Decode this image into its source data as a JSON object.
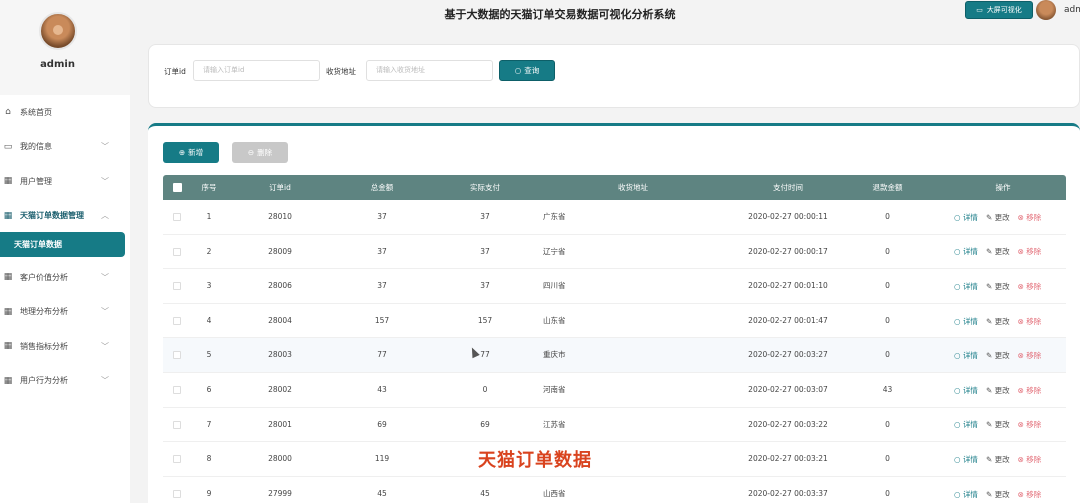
{
  "app": {
    "title": "基于大数据的天猫订单交易数据可视化分析系统",
    "bigscreen_label": "大屏可视化",
    "username": "admin",
    "username_top": "adm"
  },
  "sidebar": {
    "items": [
      {
        "label": "系统首页",
        "icon": "home-icon",
        "has_chevron": false
      },
      {
        "label": "我的信息",
        "icon": "user-card-icon",
        "has_chevron": true
      },
      {
        "label": "用户管理",
        "icon": "grid-icon",
        "has_chevron": true
      },
      {
        "label": "天猫订单数据管理",
        "icon": "grid-icon",
        "has_chevron": true,
        "open": true
      },
      {
        "label": "客户价值分析",
        "icon": "grid-icon",
        "has_chevron": true
      },
      {
        "label": "地理分布分析",
        "icon": "grid-icon",
        "has_chevron": true
      },
      {
        "label": "销售指标分析",
        "icon": "grid-icon",
        "has_chevron": true
      },
      {
        "label": "用户行为分析",
        "icon": "grid-icon",
        "has_chevron": true
      }
    ],
    "active_sub": "天猫订单数据"
  },
  "search": {
    "order_label": "订单id",
    "order_placeholder": "请输入订单id",
    "address_label": "收货地址",
    "address_placeholder": "请输入收货地址",
    "button": "查询"
  },
  "toolbar": {
    "add": "新增",
    "delete": "删除"
  },
  "table": {
    "headers": [
      "序号",
      "订单id",
      "总金额",
      "实际支付",
      "收货地址",
      "支付时间",
      "退款金额",
      "操作"
    ],
    "actions": {
      "detail": "详情",
      "edit": "更改",
      "remove": "移除"
    },
    "rows": [
      {
        "no": "1",
        "order_id": "28010",
        "total": "37",
        "paid": "37",
        "address": "广东省",
        "pay_time": "2020-02-27 00:00:11",
        "refund": "0"
      },
      {
        "no": "2",
        "order_id": "28009",
        "total": "37",
        "paid": "37",
        "address": "辽宁省",
        "pay_time": "2020-02-27 00:00:17",
        "refund": "0"
      },
      {
        "no": "3",
        "order_id": "28006",
        "total": "37",
        "paid": "37",
        "address": "四川省",
        "pay_time": "2020-02-27 00:01:10",
        "refund": "0"
      },
      {
        "no": "4",
        "order_id": "28004",
        "total": "157",
        "paid": "157",
        "address": "山东省",
        "pay_time": "2020-02-27 00:01:47",
        "refund": "0"
      },
      {
        "no": "5",
        "order_id": "28003",
        "total": "77",
        "paid": "77",
        "address": "重庆市",
        "pay_time": "2020-02-27 00:03:27",
        "refund": "0"
      },
      {
        "no": "6",
        "order_id": "28002",
        "total": "43",
        "paid": "0",
        "address": "河南省",
        "pay_time": "2020-02-27 00:03:07",
        "refund": "43"
      },
      {
        "no": "7",
        "order_id": "28001",
        "total": "69",
        "paid": "69",
        "address": "江苏省",
        "pay_time": "2020-02-27 00:03:22",
        "refund": "0"
      },
      {
        "no": "8",
        "order_id": "28000",
        "total": "119",
        "paid": "",
        "address": "",
        "pay_time": "2020-02-27 00:03:21",
        "refund": "0"
      },
      {
        "no": "9",
        "order_id": "27999",
        "total": "45",
        "paid": "45",
        "address": "山西省",
        "pay_time": "2020-02-27 00:03:37",
        "refund": "0"
      }
    ]
  },
  "overlay_caption": "天猫订单数据",
  "colors": {
    "accent": "#167b86",
    "table_header": "#5e8481",
    "remove": "#e26a75",
    "caption": "#d9431e"
  }
}
